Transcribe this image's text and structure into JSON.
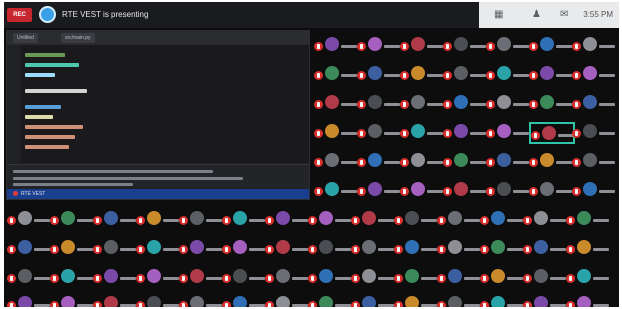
{
  "topbar": {
    "rec_label": "REC",
    "presenting_text": "RTE VEST is presenting",
    "clock": "3:55 PM"
  },
  "shared_window": {
    "tabs": [
      "Untitled",
      "src/main.py"
    ],
    "statusbar_text": "RTE VEST"
  },
  "icons": {
    "layout": "grid-icon",
    "people": "people-icon",
    "chat": "chat-icon"
  },
  "colors": {
    "mic_muted": "#d9302e",
    "highlight": "#2ec4a8",
    "presenter": "#3aa0e8"
  }
}
